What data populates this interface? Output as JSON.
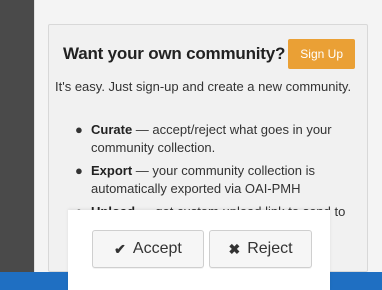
{
  "card": {
    "title": "Want your own community?",
    "signup_label": "Sign Up",
    "intro": "It's easy. Just sign-up and create a new community."
  },
  "features": [
    {
      "name": "Curate",
      "text": " — accept/reject what goes in your community collection."
    },
    {
      "name": "Export",
      "text": " — your community collection is automatically exported via OAI-PMH"
    },
    {
      "name": "Upload",
      "text": " — get custom upload link to send to"
    }
  ],
  "dialog": {
    "accept_label": "Accept",
    "reject_label": "Reject",
    "accept_icon": "check-icon",
    "reject_icon": "x-icon"
  },
  "colors": {
    "background": "#2c7fd4",
    "signup_button": "#eaa035"
  }
}
